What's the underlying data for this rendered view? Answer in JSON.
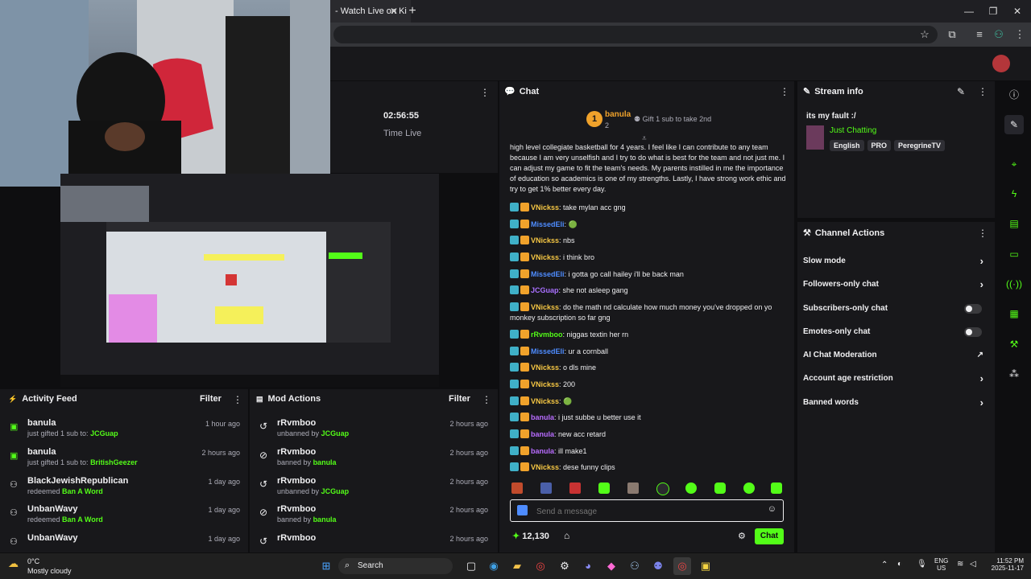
{
  "browser": {
    "tab_title": "- Watch Live on Ki",
    "close_glyph": "✕",
    "new_tab_glyph": "+",
    "min_glyph": "—",
    "max_glyph": "❐",
    "win_close_glyph": "✕"
  },
  "stream": {
    "time": "02:56:55",
    "time_label": "Time Live"
  },
  "activity_feed": {
    "title": "Activity Feed",
    "filter": "Filter",
    "items": [
      {
        "name": "banula",
        "text": "just gifted 1 sub to:",
        "target": "JCGuap",
        "time": "1 hour ago"
      },
      {
        "name": "banula",
        "text": "just gifted 1 sub to:",
        "target": "BritishGeezer",
        "time": "2 hours ago"
      },
      {
        "name": "BlackJewishRepublican",
        "text": "redeemed",
        "target": "Ban A Word",
        "time": "1 day ago"
      },
      {
        "name": "UnbanWavy",
        "text": "redeemed",
        "target": "Ban A Word",
        "time": "1 day ago"
      },
      {
        "name": "UnbanWavy",
        "text": "",
        "target": "",
        "time": "1 day ago"
      }
    ]
  },
  "mod_actions": {
    "title": "Mod Actions",
    "filter": "Filter",
    "items": [
      {
        "name": "rRvmboo",
        "text": "unbanned by",
        "target": "JCGuap",
        "time": "2 hours ago"
      },
      {
        "name": "rRvmboo",
        "text": "banned by",
        "target": "banula",
        "time": "2 hours ago"
      },
      {
        "name": "rRvmboo",
        "text": "unbanned by",
        "target": "JCGuap",
        "time": "2 hours ago"
      },
      {
        "name": "rRvmboo",
        "text": "banned by",
        "target": "banula",
        "time": "2 hours ago"
      },
      {
        "name": "rRvmboo",
        "text": "",
        "target": "",
        "time": "2 hours ago"
      }
    ]
  },
  "chat": {
    "title": "Chat",
    "pinned": {
      "rank": "1",
      "name": "banula",
      "count": "2",
      "gift": "Gift 1 sub to take 2nd"
    },
    "long_message": "high level collegiate basketball for 4 years. I feel like I can contribute to any team because I am very unselfish and I try to do what is best for the team and not just me. I can adjust my game to fit the team's needs. My parents instilled in me the importance of education so academics is one of my strengths. Lastly, I have strong work ethic and try to get 1% better every day.",
    "messages": [
      {
        "user": "VNickss",
        "color": "#f6c744",
        "text": "take mylan acc gng"
      },
      {
        "user": "MissedEli",
        "color": "#4e8cff",
        "text": "🟢"
      },
      {
        "user": "VNickss",
        "color": "#f6c744",
        "text": "nbs"
      },
      {
        "user": "VNickss",
        "color": "#f6c744",
        "text": "i think bro"
      },
      {
        "user": "MissedEli",
        "color": "#4e8cff",
        "text": "i gotta go call hailey i'll be back man"
      },
      {
        "user": "JCGuap",
        "color": "#a970ff",
        "text": "she not asleep gang"
      },
      {
        "user": "VNickss",
        "color": "#f6c744",
        "text": "do the math nd calculate how much money you've dropped on yo monkey subscription so far gng"
      },
      {
        "user": "rRvmboo",
        "color": "#53fc18",
        "text": "niggas textin her rn"
      },
      {
        "user": "MissedEli",
        "color": "#4e8cff",
        "text": "ur a cornball"
      },
      {
        "user": "VNickss",
        "color": "#f6c744",
        "text": "o dls mine"
      },
      {
        "user": "VNickss",
        "color": "#f6c744",
        "text": "200"
      },
      {
        "user": "VNickss",
        "color": "#f6c744",
        "text": "🟢"
      },
      {
        "user": "banula",
        "color": "#b86cff",
        "text": "i just subbe u better use it"
      },
      {
        "user": "banula",
        "color": "#b86cff",
        "text": "new acc retard"
      },
      {
        "user": "banula",
        "color": "#b86cff",
        "text": "ill make1"
      },
      {
        "user": "VNickss",
        "color": "#f6c744",
        "text": "dese funny clips"
      }
    ],
    "input_placeholder": "Send a message",
    "points": "12,130",
    "send_label": "Chat"
  },
  "stream_info": {
    "title": "Stream info",
    "stream_title": "its my fault :/",
    "category": "Just Chatting",
    "tags": [
      "English",
      "PRO",
      "PeregrineTV"
    ]
  },
  "channel_actions": {
    "title": "Channel Actions",
    "items": [
      {
        "label": "Slow mode",
        "control": "chevron"
      },
      {
        "label": "Followers-only chat",
        "control": "chevron"
      },
      {
        "label": "Subscribers-only chat",
        "control": "toggle"
      },
      {
        "label": "Emotes-only chat",
        "control": "toggle"
      },
      {
        "label": "AI Chat Moderation",
        "control": "external"
      },
      {
        "label": "Account age restriction",
        "control": "chevron"
      },
      {
        "label": "Banned words",
        "control": "chevron"
      }
    ]
  },
  "taskbar": {
    "weather_temp": "0°C",
    "weather_desc": "Mostly cloudy",
    "search_label": "Search",
    "lang": "ENG",
    "region": "US",
    "time": "11:52 PM",
    "date": "2025-11-17"
  },
  "colors": {
    "accent": "#53fc18",
    "panel": "#18181b",
    "bg": "#0e0e10"
  }
}
